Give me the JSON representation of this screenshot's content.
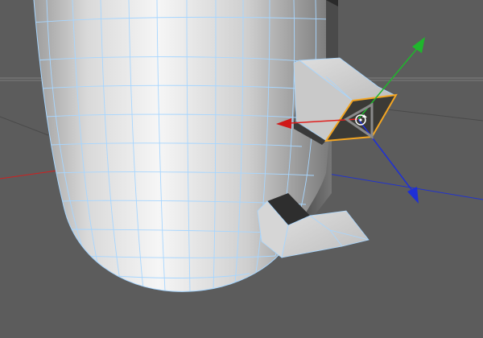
{
  "viewport": {
    "background": "#5c5c5c",
    "colors": {
      "body_light": "#f2f2f2",
      "body_dark": "#6a6a6a",
      "wireframe": "#9fd4ff",
      "selection": "#f4a623",
      "axis_x": "#e0201e",
      "axis_y": "#1fb62c",
      "axis_z": "#1e2fd6",
      "horizon": "#7a7a7a"
    }
  },
  "gizmo": {
    "axes": [
      "x-axis",
      "y-axis",
      "z-axis"
    ],
    "center_icon": "rotate-icon"
  },
  "mesh": {
    "name": "polygon-mesh",
    "selected_polygon": "extruded-face"
  }
}
